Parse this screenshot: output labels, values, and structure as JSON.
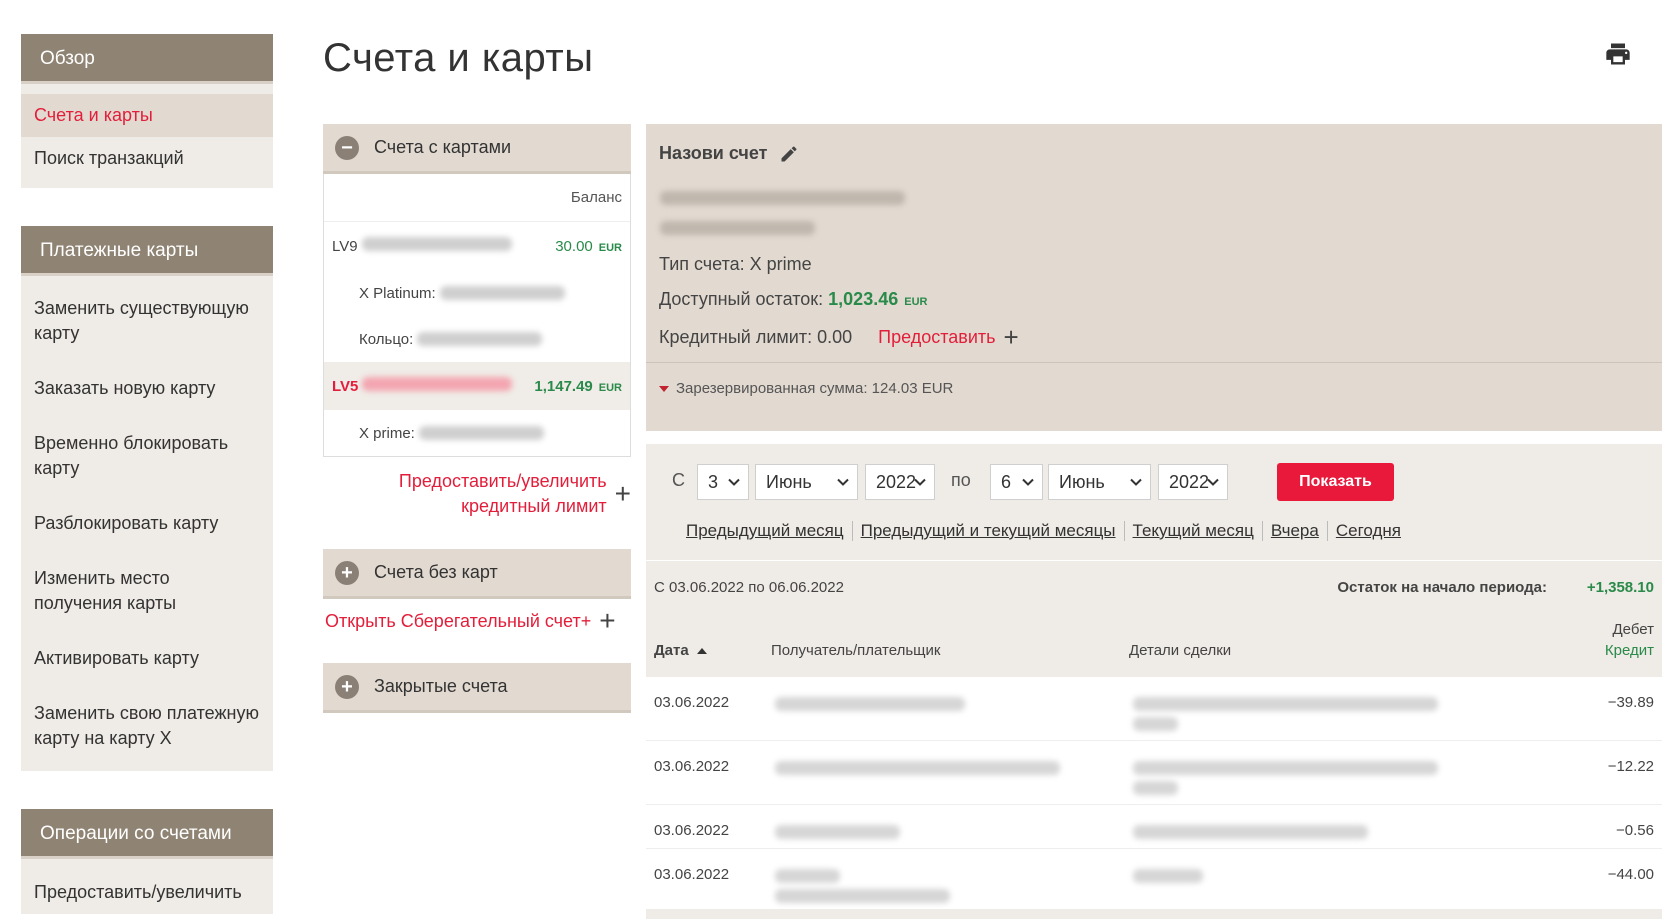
{
  "nav": {
    "overview": {
      "title": "Обзор",
      "items": [
        "Счета и карты",
        "Поиск транзакций"
      ]
    },
    "cards": {
      "title": "Платежные карты",
      "items": [
        "Заменить существующую карту",
        "Заказать новую карту",
        "Временно блокировать карту",
        "Разблокировать карту",
        "Изменить место получения карты",
        "Активировать карту",
        "Заменить свою платежную карту на карту X"
      ]
    },
    "operations": {
      "title": "Операции со счетами",
      "items": [
        "Предоставить/увеличить"
      ]
    }
  },
  "page": {
    "title": "Счета и карты"
  },
  "accounts": {
    "with_cards_title": "Счета с картами",
    "balance_header": "Баланс",
    "rows": [
      {
        "prefix": "LV9",
        "amount": "30.00",
        "currency": "EUR"
      },
      {
        "label": "X Platinum:"
      },
      {
        "label": "Кольцо:"
      },
      {
        "prefix": "LV5",
        "amount": "1,147.49",
        "currency": "EUR"
      },
      {
        "label": "X prime:"
      }
    ],
    "credit_link": "Предоставить/увеличить кредитный лимит",
    "no_cards_title": "Счета без карт",
    "open_savings": "Открыть Сберегательный счет+",
    "closed_title": "Закрытые счета"
  },
  "detail": {
    "title": "Назови счет",
    "type_label": "Тип счета: X prime",
    "available_label": "Доступный остаток:",
    "available_value": "1,023.46",
    "available_currency": "EUR",
    "credit_label": "Кредитный лимит: 0.00",
    "credit_action": "Предоставить",
    "reserved": "Зарезервированная сумма: 124.03 EUR"
  },
  "filter": {
    "from_label": "С",
    "to_label": "по",
    "from_day": "3",
    "from_month": "Июнь",
    "from_year": "2022",
    "to_day": "6",
    "to_month": "Июнь",
    "to_year": "2022",
    "show": "Показать",
    "quick": [
      "Предыдущий месяц",
      "Предыдущий и текущий месяцы",
      "Текущий месяц",
      "Вчера",
      "Сегодня"
    ]
  },
  "transactions": {
    "period": "С 03.06.2022 по 06.06.2022",
    "opening_label": "Остаток на начало периода:",
    "opening_value": "+1,358.10",
    "col_date": "Дата",
    "col_party": "Получатель/плательщик",
    "col_details": "Детали сделки",
    "col_debit": "Дебет",
    "col_credit": "Кредит",
    "rows": [
      {
        "date": "03.06.2022",
        "amount": "−39.89"
      },
      {
        "date": "03.06.2022",
        "amount": "−12.22"
      },
      {
        "date": "03.06.2022",
        "amount": "−0.56"
      },
      {
        "date": "03.06.2022",
        "amount": "−44.00"
      }
    ]
  }
}
